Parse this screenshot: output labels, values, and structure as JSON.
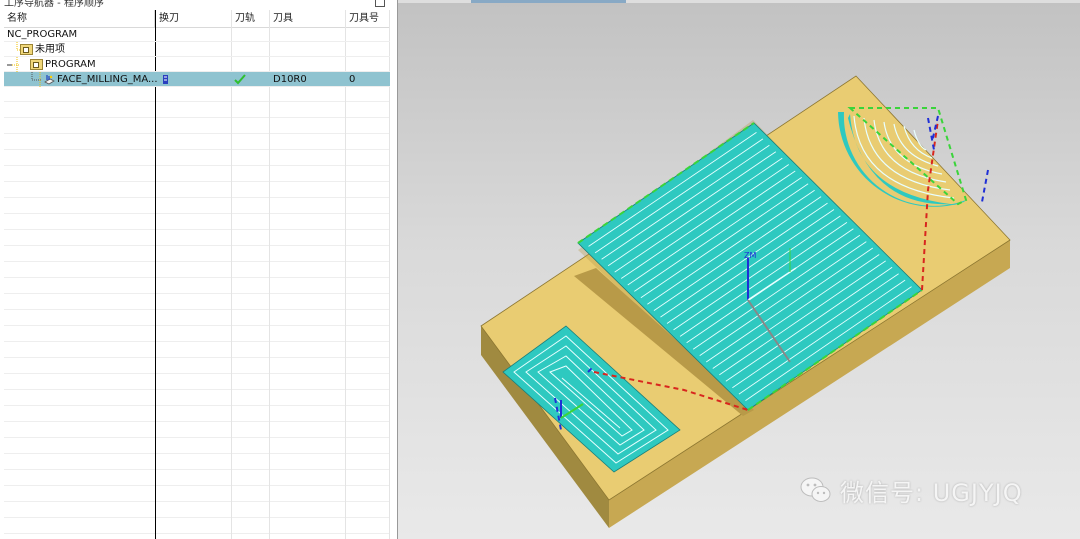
{
  "navigator": {
    "title": "工序导航器 - 程序顺序",
    "columns": {
      "name": "名称",
      "tool_change": "换刀",
      "toolpath": "刀轨",
      "tool": "刀具",
      "tool_number": "刀具号"
    },
    "tree": {
      "root": "NC_PROGRAM",
      "unused": "未用项",
      "program": "PROGRAM",
      "operation": {
        "name": "FACE_MILLING_MA...",
        "toolpath_status_icon": "check-icon",
        "tool": "D10R0",
        "tool_number": "0"
      }
    }
  },
  "viewport": {
    "watermark_text": "微信号: UGJYJQ",
    "colors": {
      "stock": "#e9cc72",
      "toolpath": "#2ec9c0",
      "engage": "#3ad43a",
      "rapid": "#d8261e",
      "axis": "#1f2fd6"
    }
  }
}
